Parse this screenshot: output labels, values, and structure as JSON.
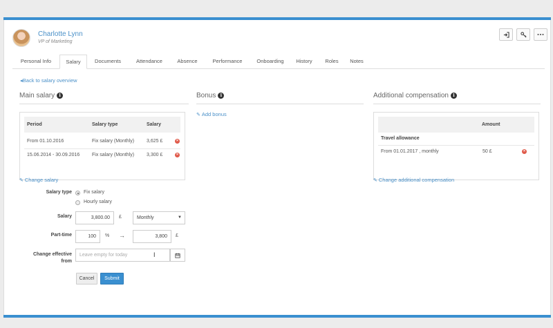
{
  "profile": {
    "name": "Charlotte Lynn",
    "title": "VP of Marketing",
    "actions": [
      "login-icon",
      "key-icon",
      "more-icon"
    ]
  },
  "tabs": [
    {
      "label": "Personal Info",
      "active": false
    },
    {
      "label": "Salary",
      "active": true
    },
    {
      "label": "Documents",
      "active": false
    },
    {
      "label": "Attendance",
      "active": false
    },
    {
      "label": "Absence",
      "active": false
    },
    {
      "label": "Performance",
      "active": false
    },
    {
      "label": "Onboarding",
      "active": false
    },
    {
      "label": "History",
      "active": false
    },
    {
      "label": "Roles",
      "active": false
    },
    {
      "label": "Notes",
      "active": false
    }
  ],
  "back_link": "Back to salary overview",
  "main_salary": {
    "title": "Main salary",
    "columns": [
      "Period",
      "Salary type",
      "Salary"
    ],
    "rows": [
      {
        "period": "From 01.10.2016",
        "type": "Fix salary (Monthly)",
        "salary": "3,625 £"
      },
      {
        "period": "15.06.2014 - 30.09.2016",
        "type": "Fix salary (Monthly)",
        "salary": "3,300 £"
      }
    ],
    "change_link": "Change salary"
  },
  "bonus": {
    "title": "Bonus",
    "add_link": "Add bonus"
  },
  "additional": {
    "title": "Additional compensation",
    "amount_header": "Amount",
    "group": "Travel allowance",
    "row": {
      "period": "From 01.01.2017 , monthly",
      "amount": "50 £"
    },
    "change_link": "Change additional compensation"
  },
  "form": {
    "salary_type_label": "Salary type",
    "options": [
      "Fix salary",
      "Hourly salary"
    ],
    "selected_option": "Fix salary",
    "salary_label": "Salary",
    "salary_value": "3,800.00",
    "currency": "£",
    "frequency": "Monthly",
    "parttime_label": "Part-time",
    "parttime_value": "100",
    "percent": "%",
    "arrow": "→",
    "computed_value": "3,800",
    "effective_label_line1": "Change effective",
    "effective_label_line2": "from",
    "effective_placeholder": "Leave empty for today",
    "cancel": "Cancel",
    "submit": "Submit"
  },
  "colors": {
    "accent": "#3a8fd0",
    "link": "#4a90c8",
    "danger": "#e05a4a"
  }
}
